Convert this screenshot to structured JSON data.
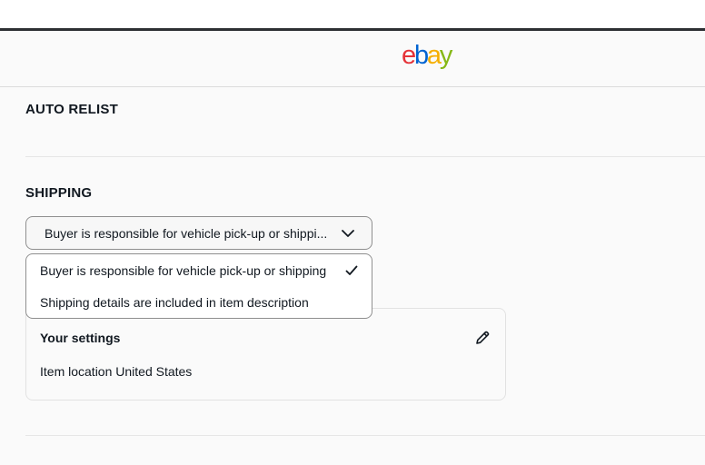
{
  "header": {
    "logo_letters": [
      {
        "char": "e",
        "color": "#e53238"
      },
      {
        "char": "b",
        "color": "#0064d2"
      },
      {
        "char": "a",
        "color": "#f5af02"
      },
      {
        "char": "y",
        "color": "#86b817"
      }
    ]
  },
  "auto_relist": {
    "title": "AUTO RELIST"
  },
  "shipping": {
    "title": "SHIPPING",
    "select": {
      "value": "Buyer is responsible for vehicle pick-up or shippi...",
      "icon": "chevron-down-icon"
    },
    "options": [
      {
        "label": "Buyer is responsible for vehicle pick-up or shipping",
        "selected": true,
        "icon": "checkmark-icon"
      },
      {
        "label": "Shipping details are included in item description",
        "selected": false
      }
    ],
    "settings_card": {
      "title": "Your settings",
      "location_text": "Item location United States",
      "edit_icon": "pencil-icon"
    }
  },
  "colors": {
    "text": "#111820",
    "border": "#8f8f8f",
    "page_background": "#fafafa"
  }
}
